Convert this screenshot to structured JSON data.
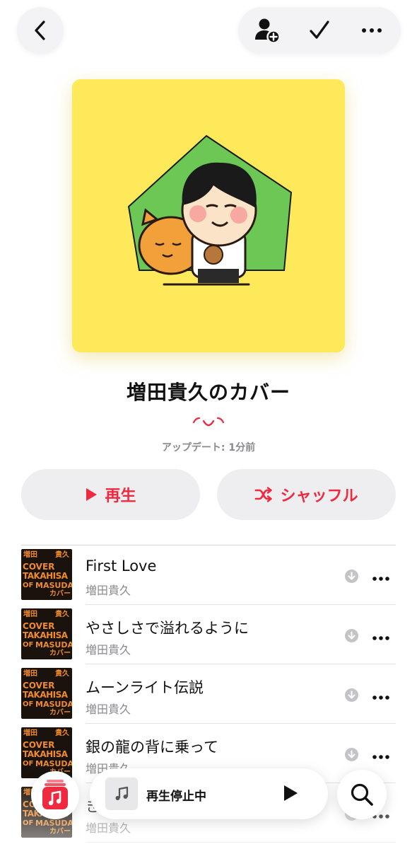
{
  "header": {
    "back_icon": "chevron-left-icon",
    "add_person_icon": "person-add-icon",
    "check_icon": "checkmark-icon",
    "more_icon": "ellipsis-icon"
  },
  "playlist": {
    "title": "増田貴久のカバー",
    "updated": "アップデート: 1分前"
  },
  "actions": {
    "play_label": "再生",
    "shuffle_label": "シャッフル",
    "accent_color": "#ef2a40"
  },
  "tracks": [
    {
      "title": "First Love",
      "artist": "増田貴久"
    },
    {
      "title": "やさしさで溢れるように",
      "artist": "増田貴久"
    },
    {
      "title": "ムーンライト伝説",
      "artist": "増田貴久"
    },
    {
      "title": "銀の龍の背に乗って",
      "artist": "増田貴久"
    },
    {
      "title": "き",
      "artist": "増田貴久"
    }
  ],
  "thumb_text": {
    "top_left": "増田",
    "top_right": "貴久",
    "cover": "COVER",
    "takahisa": "TAKAHISA",
    "of": "OF",
    "masuda": "MASUDA",
    "kaba": "カバー"
  },
  "mini_player": {
    "status": "再生停止中"
  },
  "tab": {
    "music_icon": "apple-music-icon",
    "search_icon": "search-icon"
  }
}
